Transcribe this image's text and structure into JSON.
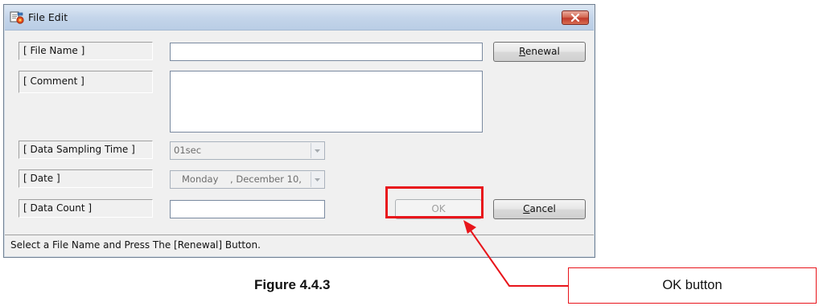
{
  "window": {
    "title": "File Edit",
    "icon": "file-edit-app-icon",
    "close_icon": "close-icon"
  },
  "fields": {
    "file_name": {
      "label": "[ File Name ]",
      "value": ""
    },
    "comment": {
      "label": "[ Comment ]",
      "value": ""
    },
    "data_sampling_time": {
      "label": "[ Data Sampling Time ]",
      "value": "01sec"
    },
    "date": {
      "label": "[ Date ]",
      "value": "Monday    , December 10,"
    },
    "data_count": {
      "label": "[ Data Count ]",
      "value": ""
    }
  },
  "buttons": {
    "renewal": {
      "label": "Renewal",
      "mnemonic": "R"
    },
    "ok": {
      "label": "OK",
      "enabled": false
    },
    "cancel": {
      "label": "Cancel",
      "mnemonic": "C"
    }
  },
  "status_text": "Select a File Name and Press The [Renewal] Button.",
  "annotation": {
    "figure_caption": "Figure 4.4.3",
    "callout_text": "OK button",
    "highlight_color": "#e8151b"
  }
}
